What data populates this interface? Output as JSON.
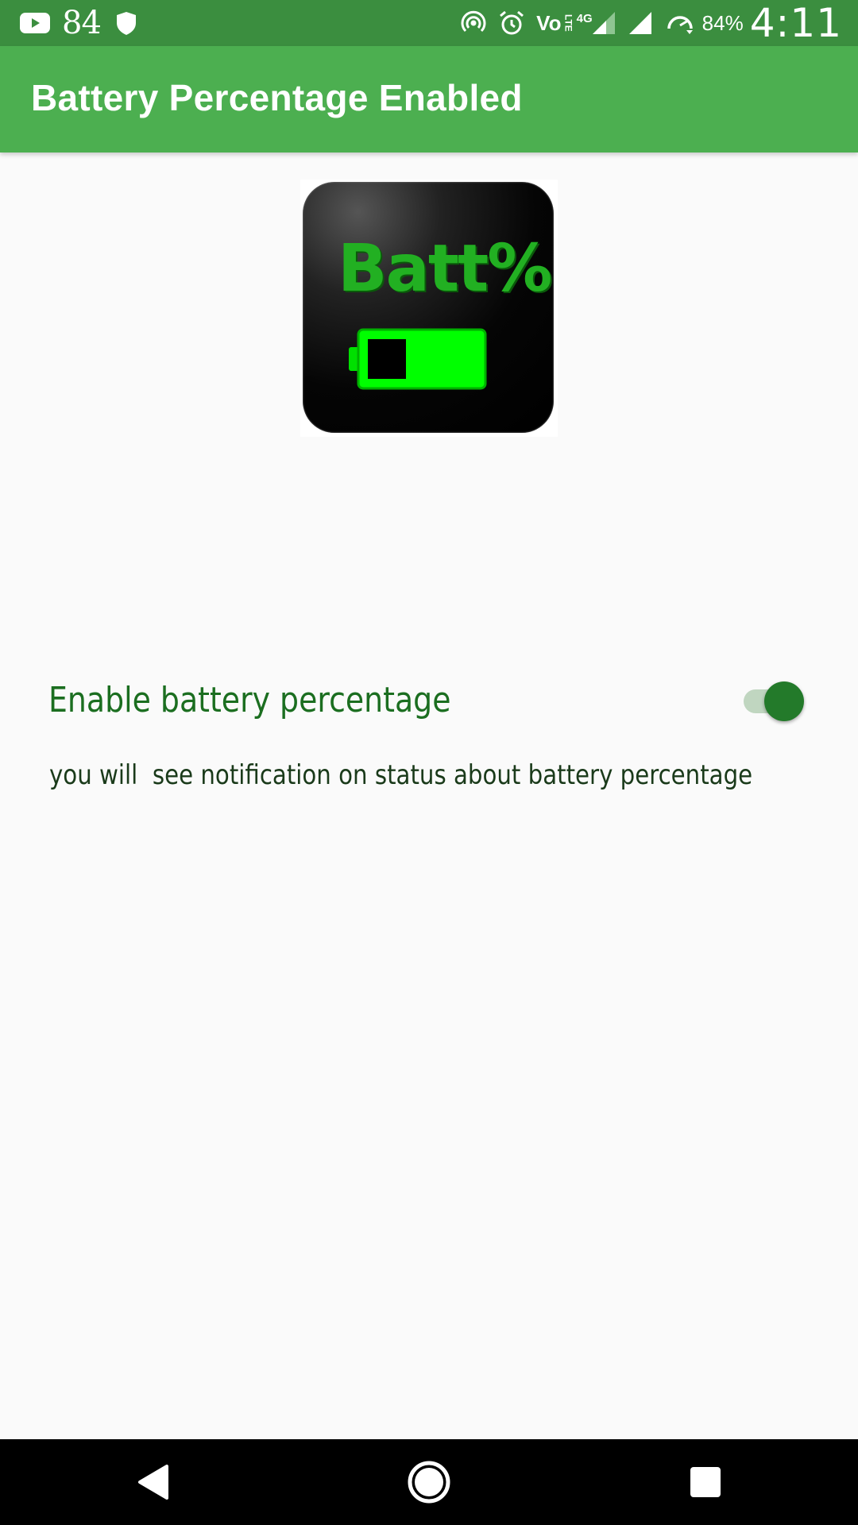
{
  "status_bar": {
    "notification_count": "84",
    "volte_label": "Vo",
    "lte_label": "LTE",
    "network_type": "4G",
    "battery_percent": "84%",
    "time": "4:11",
    "icons": [
      "youtube-icon",
      "shield-icon",
      "hotspot-icon",
      "alarm-icon",
      "volte-icon",
      "signal-icon",
      "signal-icon",
      "data-saver-icon"
    ]
  },
  "app_bar": {
    "title": "Battery Percentage Enabled"
  },
  "app_icon": {
    "text": "Batt%",
    "battery_fill": 0.65,
    "colors": {
      "background": "#000000",
      "text": "#22b022",
      "battery": "#00ff00"
    }
  },
  "setting": {
    "title": "Enable battery percentage",
    "description": "you will  see notification on status about battery percentage",
    "toggle_on": true
  },
  "nav_bar": {
    "icons": [
      "back-icon",
      "home-icon",
      "recents-icon"
    ]
  },
  "colors": {
    "status_bar": "#3b8e3f",
    "app_bar": "#4caf50",
    "accent": "#237a2a",
    "setting_title": "#1b6e20"
  }
}
